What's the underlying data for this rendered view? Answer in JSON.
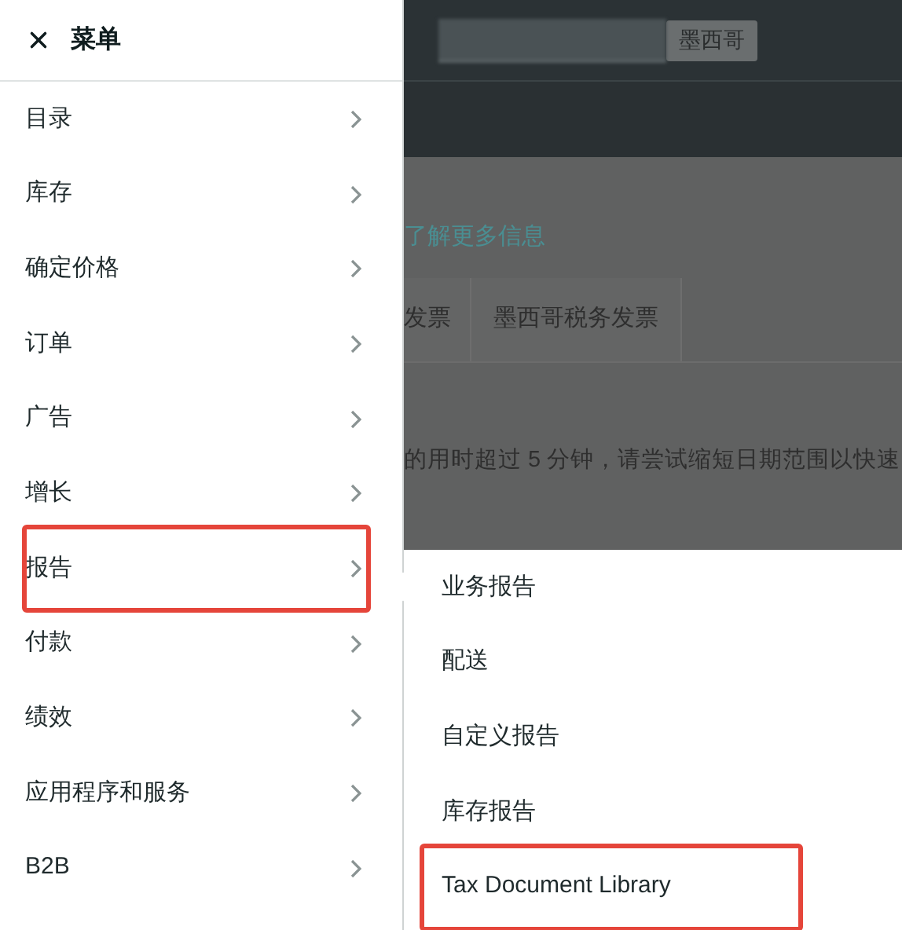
{
  "menu": {
    "title": "菜单",
    "items": [
      {
        "label": "目录",
        "highlighted": false
      },
      {
        "label": "库存",
        "highlighted": false
      },
      {
        "label": "确定价格",
        "highlighted": false
      },
      {
        "label": "订单",
        "highlighted": false
      },
      {
        "label": "广告",
        "highlighted": false
      },
      {
        "label": "增长",
        "highlighted": false
      },
      {
        "label": "报告",
        "highlighted": true
      },
      {
        "label": "付款",
        "highlighted": false
      },
      {
        "label": "绩效",
        "highlighted": false
      },
      {
        "label": "应用程序和服务",
        "highlighted": false
      },
      {
        "label": "B2B",
        "highlighted": false
      }
    ]
  },
  "submenu": {
    "items": [
      {
        "label": "业务报告",
        "highlighted": false
      },
      {
        "label": "配送",
        "highlighted": false
      },
      {
        "label": "自定义报告",
        "highlighted": false
      },
      {
        "label": "库存报告",
        "highlighted": false
      },
      {
        "label": "Tax Document Library",
        "highlighted": true
      }
    ]
  },
  "background_page": {
    "country_button": "墨西哥",
    "link": "了解更多信息",
    "tabs": [
      {
        "label": "发票"
      },
      {
        "label": "墨西哥税务发票"
      }
    ],
    "notice": "的用时超过 5 分钟，请尝试缩短日期范围以快速"
  }
}
